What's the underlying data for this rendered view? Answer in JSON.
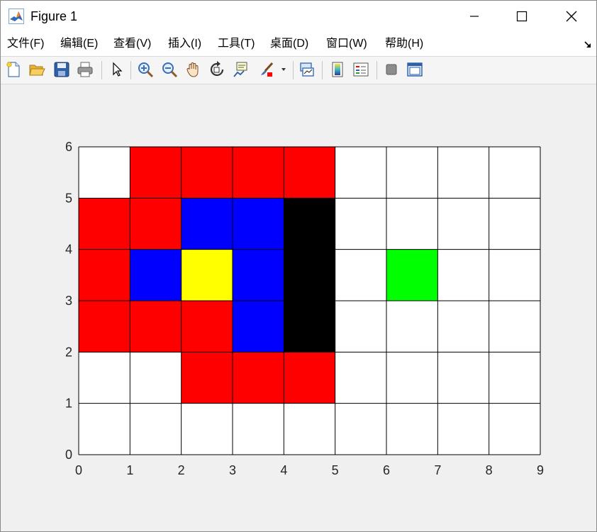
{
  "window": {
    "title": "Figure 1",
    "app_icon": "matlab-icon",
    "controls": [
      "minimize-icon",
      "maximize-icon",
      "close-icon"
    ]
  },
  "menubar": {
    "items": [
      {
        "label": "文件(F)",
        "name": "menu-file"
      },
      {
        "label": "编辑(E)",
        "name": "menu-edit"
      },
      {
        "label": "查看(V)",
        "name": "menu-view"
      },
      {
        "label": "插入(I)",
        "name": "menu-insert"
      },
      {
        "label": "工具(T)",
        "name": "menu-tools"
      },
      {
        "label": "桌面(D)",
        "name": "menu-desktop"
      },
      {
        "label": "窗口(W)",
        "name": "menu-window"
      },
      {
        "label": "帮助(H)",
        "name": "menu-help"
      }
    ],
    "dock_icon": "dock-arrow-icon"
  },
  "toolbar": {
    "buttons": [
      "new-figure-icon",
      "open-file-icon",
      "save-icon",
      "print-icon",
      "pointer-icon",
      "zoom-in-icon",
      "zoom-out-icon",
      "pan-hand-icon",
      "rotate-3d-icon",
      "data-cursor-icon",
      "brush-icon",
      "brush-dropdown-icon",
      "link-plot-icon",
      "colorbar-icon",
      "legend-icon",
      "hide-plot-tools-icon",
      "show-plot-tools-icon"
    ]
  },
  "chart_data": {
    "type": "heatmap",
    "xlim": [
      0,
      9
    ],
    "ylim": [
      0,
      6
    ],
    "x_ticks": [
      "0",
      "1",
      "2",
      "3",
      "4",
      "5",
      "6",
      "7",
      "8",
      "9"
    ],
    "y_ticks": [
      "0",
      "1",
      "2",
      "3",
      "4",
      "5",
      "6"
    ],
    "grid": true,
    "colors": {
      "W": "#ffffff",
      "R": "#ff0000",
      "B": "#0000ff",
      "Y": "#ffff00",
      "K": "#000000",
      "G": "#00ff00"
    },
    "rows_top_to_bottom": [
      [
        "W",
        "R",
        "R",
        "R",
        "R",
        "W",
        "W",
        "W",
        "W"
      ],
      [
        "R",
        "R",
        "B",
        "B",
        "K",
        "W",
        "W",
        "W",
        "W"
      ],
      [
        "R",
        "B",
        "Y",
        "B",
        "K",
        "W",
        "G",
        "W",
        "W"
      ],
      [
        "R",
        "R",
        "R",
        "B",
        "K",
        "W",
        "W",
        "W",
        "W"
      ],
      [
        "W",
        "W",
        "R",
        "R",
        "R",
        "W",
        "W",
        "W",
        "W"
      ],
      [
        "W",
        "W",
        "W",
        "W",
        "W",
        "W",
        "W",
        "W",
        "W"
      ]
    ]
  }
}
